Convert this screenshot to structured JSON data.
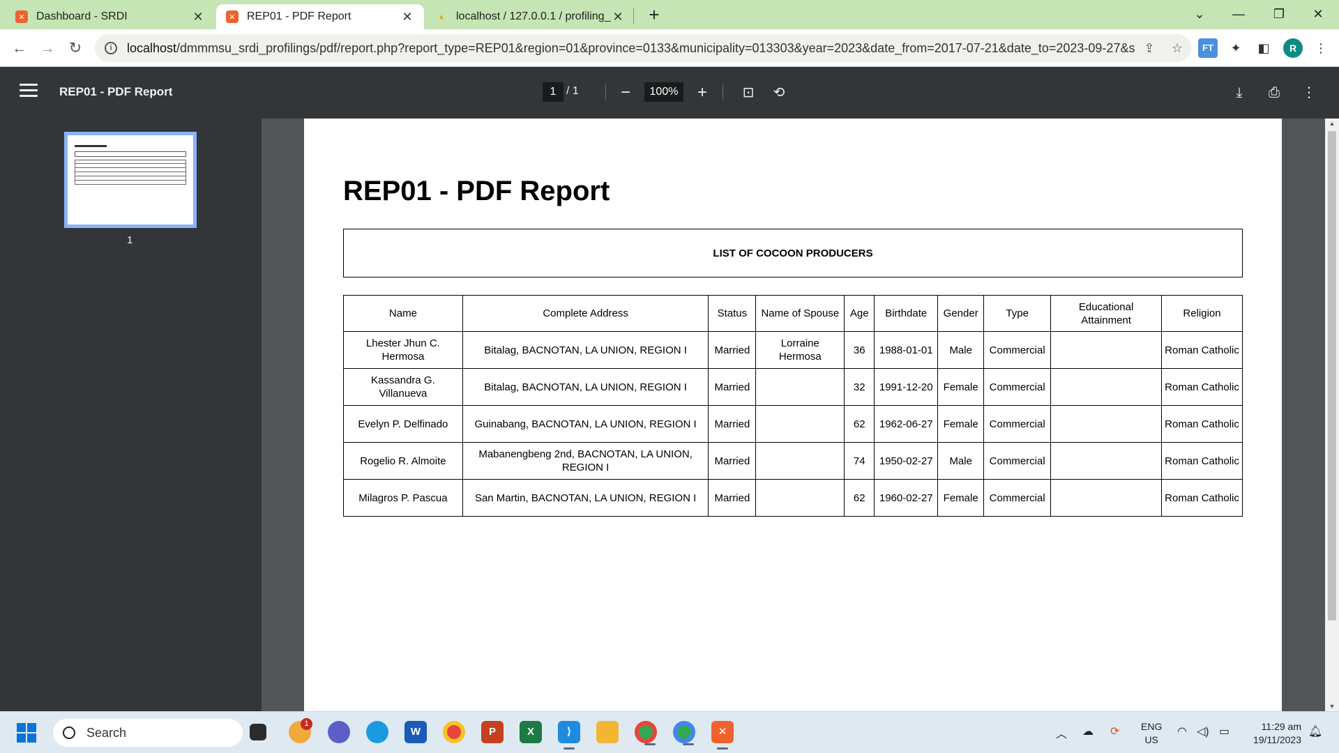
{
  "browser": {
    "tabs": [
      {
        "title": "Dashboard - SRDI",
        "active": false
      },
      {
        "title": "REP01 - PDF Report",
        "active": true
      },
      {
        "title": "localhost / 127.0.0.1 / profiling_s",
        "active": false
      }
    ],
    "url_host": "localhost",
    "url_rest": "/dmmmsu_srdi_profilings/pdf/report.php?report_type=REP01&region=01&province=0133&municipality=013303&year=2023&date_from=2017-07-21&date_to=2023-09-27&s...",
    "profile_initial": "R",
    "extension_label": "FT"
  },
  "pdf_viewer": {
    "title": "REP01 - PDF Report",
    "current_page": "1",
    "page_total": "/  1",
    "zoom": "100%",
    "thumbnail_label": "1"
  },
  "report": {
    "heading": "REP01 - PDF Report",
    "list_title": "LIST OF COCOON PRODUCERS",
    "columns": [
      "Name",
      "Complete Address",
      "Status",
      "Name of Spouse",
      "Age",
      "Birthdate",
      "Gender",
      "Type",
      "Educational Attainment",
      "Religion"
    ],
    "rows": [
      [
        "Lhester Jhun C. Hermosa",
        "Bitalag, BACNOTAN, LA UNION, REGION I",
        "Married",
        "Lorraine Hermosa",
        "36",
        "1988-01-01",
        "Male",
        "Commercial",
        "",
        "Roman Catholic"
      ],
      [
        "Kassandra G. Villanueva",
        "Bitalag, BACNOTAN, LA UNION, REGION I",
        "Married",
        "",
        "32",
        "1991-12-20",
        "Female",
        "Commercial",
        "",
        "Roman Catholic"
      ],
      [
        "Evelyn P. Delfinado",
        "Guinabang, BACNOTAN, LA UNION, REGION I",
        "Married",
        "",
        "62",
        "1962-06-27",
        "Female",
        "Commercial",
        "",
        "Roman Catholic"
      ],
      [
        "Rogelio R. Almoite",
        "Mabanengbeng 2nd, BACNOTAN, LA UNION, REGION I",
        "Married",
        "",
        "74",
        "1950-02-27",
        "Male",
        "Commercial",
        "",
        "Roman Catholic"
      ],
      [
        "Milagros P. Pascua",
        "San Martin, BACNOTAN, LA UNION, REGION I",
        "Married",
        "",
        "62",
        "1960-02-27",
        "Female",
        "Commercial",
        "",
        "Roman Catholic"
      ]
    ]
  },
  "taskbar": {
    "search_label": "Search",
    "notification_count": "1",
    "language": "ENG",
    "region": "US",
    "time": "11:29 am",
    "date": "19/11/2023"
  },
  "colors": {
    "tabstrip": "#c5e5b4",
    "pdf_toolbar": "#323639",
    "viewer_bg": "#525659",
    "thumb_highlight": "#8ab4f8"
  }
}
